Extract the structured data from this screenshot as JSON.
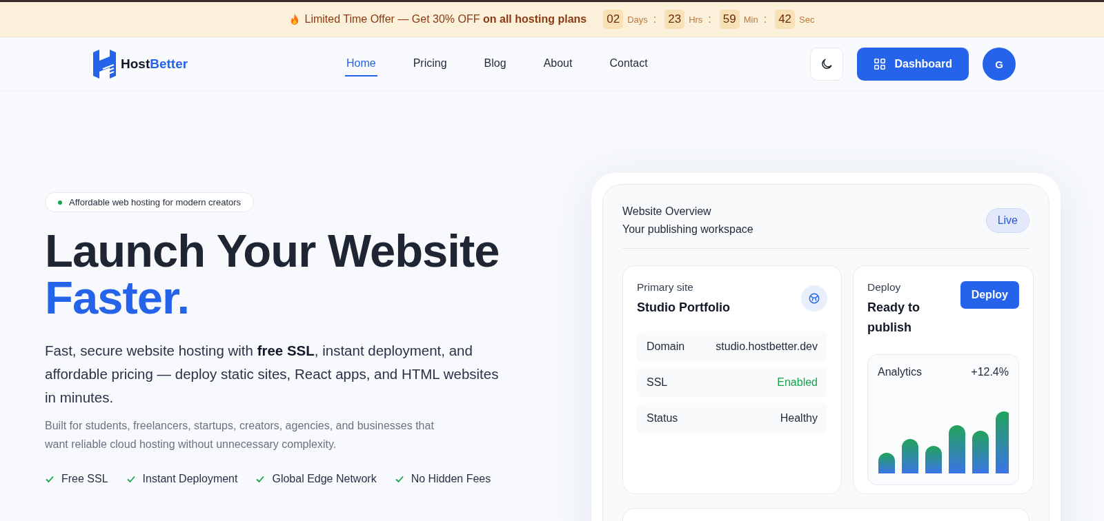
{
  "promo_banner": {
    "text": "Limited Time Offer — Get 30% OFF **on all hosting plans**",
    "countdown": [
      {
        "value": "02",
        "unit": "Days",
        "separator": ":"
      },
      {
        "value": "23",
        "unit": "Hrs",
        "separator": ":"
      },
      {
        "value": "59",
        "unit": "Min",
        "separator": ":"
      },
      {
        "value": "42",
        "unit": "Sec"
      }
    ]
  },
  "navbar": {
    "brand": {
      "part_1": "Host",
      "part_2": "Better"
    },
    "links": [
      {
        "label": "Home",
        "selected": true
      },
      {
        "label": "Pricing",
        "selected": false
      },
      {
        "label": "Blog",
        "selected": false
      },
      {
        "label": "About",
        "selected": false
      },
      {
        "label": "Contact",
        "selected": false
      }
    ],
    "dashboard_button": "Dashboard",
    "avatar": "G"
  },
  "hero": {
    "badge": "Affordable web hosting for modern creators",
    "headline_1": "Launch Your Website",
    "headline_2": "Faster.",
    "description": "Fast, secure website hosting with **free SSL**, instant deployment, and affordable pricing — deploy static sites, React apps, and HTML websites in minutes.",
    "subtext": "Built for students, freelancers, startups, creators, agencies, and businesses that want reliable cloud hosting without unnecessary complexity.",
    "features": [
      "Free SSL",
      "Instant Deployment",
      "Global Edge Network",
      "No Hidden Fees"
    ]
  },
  "overview_card": {
    "title": "Website Overview",
    "subtitle": "Your publishing workspace",
    "status": "Live",
    "primary_site": {
      "label": "Primary site",
      "name": "Studio Portfolio",
      "rows": [
        {
          "label": "Domain",
          "value": "studio.hostbetter.dev",
          "color": "#1f2937"
        },
        {
          "label": "SSL",
          "value": "Enabled",
          "color": "#16a34a"
        },
        {
          "label": "Status",
          "value": "Healthy",
          "color": "#1f2937"
        }
      ]
    },
    "deploy": {
      "label": "Deploy",
      "title": "Ready to publish",
      "button": "Deploy"
    },
    "analytics": {
      "label": "Analytics",
      "change": "+12.4%"
    }
  }
}
